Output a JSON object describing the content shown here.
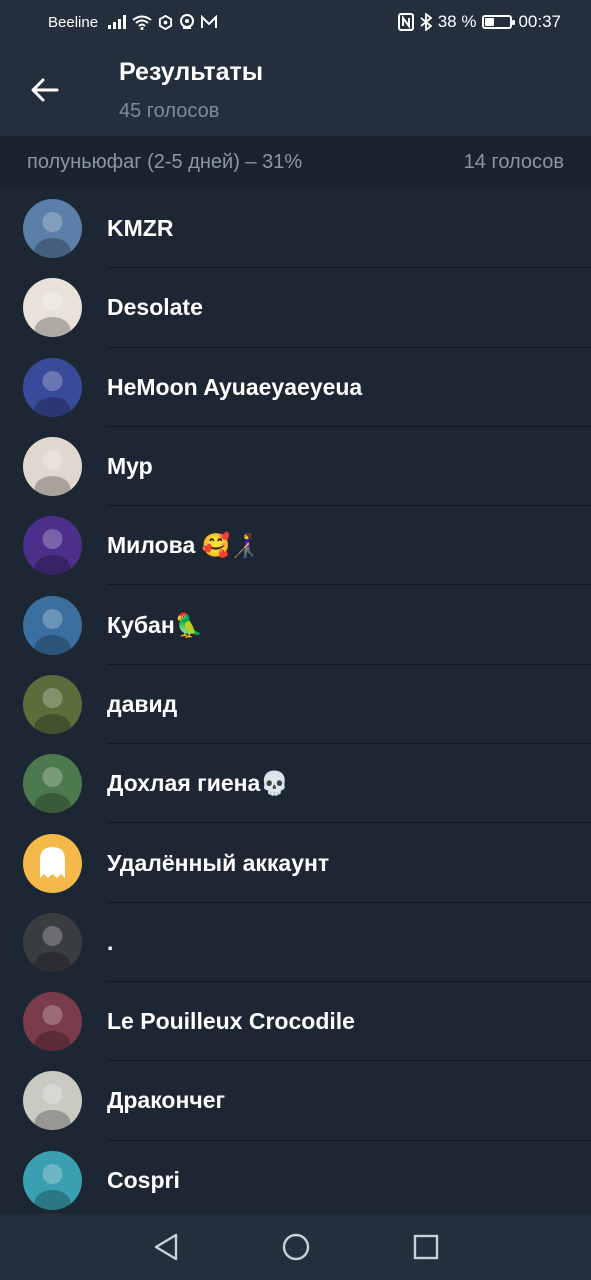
{
  "status_bar": {
    "carrier": "Beeline",
    "battery_text": "38 %",
    "battery_level": 0.38,
    "time": "00:37",
    "icons": [
      "signal-icon",
      "wifi-icon",
      "hexagon-icon",
      "camera-icon",
      "mail-icon",
      "nfc-icon",
      "bluetooth-icon",
      "battery-icon"
    ]
  },
  "header": {
    "title": "Результаты",
    "subtitle": "45 голосов"
  },
  "section": {
    "label": "полуньюфаг (2-5 дней) – 31%",
    "count": "14 голосов"
  },
  "voters": [
    {
      "name": "KMZR",
      "avatar_bg": "#5b7fa8"
    },
    {
      "name": "Desolate",
      "avatar_bg": "#e8e2d8"
    },
    {
      "name": "HeMoon Ayuaeyaeyeua",
      "avatar_bg": "#3a4a9a"
    },
    {
      "name": "Мур",
      "avatar_bg": "#e0d8cf"
    },
    {
      "name": "Милова 🥰👩‍🦯",
      "avatar_bg": "#4b2f8a"
    },
    {
      "name": "Кубан🦜",
      "avatar_bg": "#3b6fa0"
    },
    {
      "name": "давид",
      "avatar_bg": "#5a6e3c"
    },
    {
      "name": "Дохлая гиена💀",
      "avatar_bg": "#4c7a4e"
    },
    {
      "name": "Удалённый аккаунт",
      "avatar_bg": "#f5b94a"
    },
    {
      "name": ".",
      "avatar_bg": "#3a3d40"
    },
    {
      "name": "Le Pouilleux Crocodile",
      "avatar_bg": "#7a3b4a"
    },
    {
      "name": "Дракончег",
      "avatar_bg": "#c9cbc2"
    },
    {
      "name": "Cospri",
      "avatar_bg": "#3a9fb0"
    }
  ]
}
